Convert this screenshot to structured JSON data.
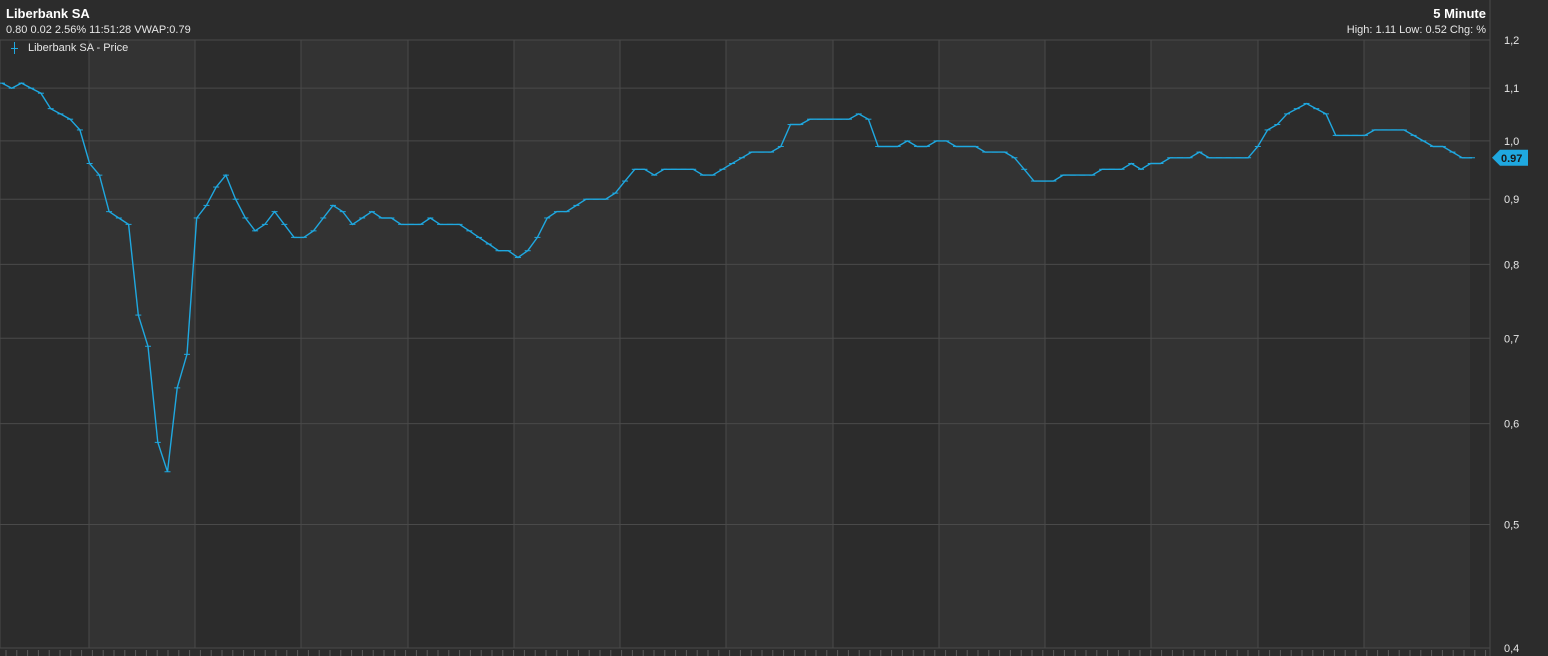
{
  "header": {
    "title": "Liberbank SA",
    "subline": "0.80 0.02 2.56% 11:51:28 VWAP:0.79",
    "interval": "5 Minute",
    "stats": "High: 1.11 Low: 0.52 Chg: %"
  },
  "legend": {
    "label": "Liberbank SA - Price"
  },
  "colors": {
    "background": "#2c2c2c",
    "band": "#333333",
    "series": "#1fa8e0",
    "grid": "#4a4a4a"
  },
  "chart_data": {
    "type": "line",
    "title": "Liberbank SA",
    "y_scale": "log",
    "ylim": [
      0.4,
      1.2
    ],
    "yticks": [
      1.2,
      1.1,
      1.0,
      0.9,
      0.8,
      0.7,
      0.6,
      0.5,
      0.4
    ],
    "ytick_labels": [
      "1,2",
      "1,1",
      "1,0",
      "0,9",
      "0,8",
      "0,7",
      "0,6",
      "0,5",
      "0,4"
    ],
    "x_divisions": 13,
    "last_value": 0.97,
    "last_value_label": "0.97",
    "high": 1.11,
    "low": 0.52,
    "series": [
      {
        "name": "Liberbank SA - Price",
        "values": [
          1.11,
          1.1,
          1.11,
          1.1,
          1.09,
          1.06,
          1.05,
          1.04,
          1.02,
          0.96,
          0.94,
          0.88,
          0.87,
          0.86,
          0.73,
          0.69,
          0.58,
          0.55,
          0.64,
          0.68,
          0.87,
          0.89,
          0.92,
          0.94,
          0.9,
          0.87,
          0.85,
          0.86,
          0.88,
          0.86,
          0.84,
          0.84,
          0.85,
          0.87,
          0.89,
          0.88,
          0.86,
          0.87,
          0.88,
          0.87,
          0.87,
          0.86,
          0.86,
          0.86,
          0.87,
          0.86,
          0.86,
          0.86,
          0.85,
          0.84,
          0.83,
          0.82,
          0.82,
          0.81,
          0.82,
          0.84,
          0.87,
          0.88,
          0.88,
          0.89,
          0.9,
          0.9,
          0.9,
          0.91,
          0.93,
          0.95,
          0.95,
          0.94,
          0.95,
          0.95,
          0.95,
          0.95,
          0.94,
          0.94,
          0.95,
          0.96,
          0.97,
          0.98,
          0.98,
          0.98,
          0.99,
          1.03,
          1.03,
          1.04,
          1.04,
          1.04,
          1.04,
          1.04,
          1.05,
          1.04,
          0.99,
          0.99,
          0.99,
          1.0,
          0.99,
          0.99,
          1.0,
          1.0,
          0.99,
          0.99,
          0.99,
          0.98,
          0.98,
          0.98,
          0.97,
          0.95,
          0.93,
          0.93,
          0.93,
          0.94,
          0.94,
          0.94,
          0.94,
          0.95,
          0.95,
          0.95,
          0.96,
          0.95,
          0.96,
          0.96,
          0.97,
          0.97,
          0.97,
          0.98,
          0.97,
          0.97,
          0.97,
          0.97,
          0.97,
          0.99,
          1.02,
          1.03,
          1.05,
          1.06,
          1.07,
          1.06,
          1.05,
          1.01,
          1.01,
          1.01,
          1.01,
          1.02,
          1.02,
          1.02,
          1.02,
          1.01,
          1.0,
          0.99,
          0.99,
          0.98,
          0.97,
          0.97
        ]
      }
    ]
  }
}
